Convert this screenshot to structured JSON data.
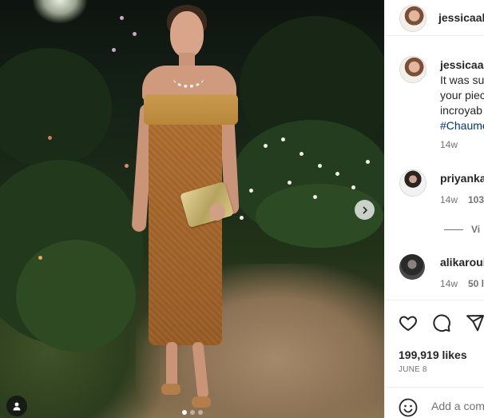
{
  "post": {
    "username": "jessicaalba",
    "carousel": {
      "slide_index": 1,
      "slide_count": 3
    }
  },
  "caption": {
    "username": "jessicaalba",
    "lines": [
      "It was su",
      "your piec",
      "incroyab"
    ],
    "hashtag": "#Chaume",
    "time": "14w"
  },
  "comments": [
    {
      "username": "priyanka",
      "time": "14w",
      "likes": "103"
    },
    {
      "username": "alikaroui",
      "time": "14w",
      "likes": "50 l"
    }
  ],
  "view_replies": "Vi",
  "likes": "199,919 likes",
  "date": "JUNE 8",
  "add_comment_placeholder": "Add a com",
  "icons": {
    "next": "chevron-right-icon",
    "tag": "user-tag-icon",
    "like": "heart-icon",
    "comment": "comment-icon",
    "share": "share-icon",
    "emoji": "emoji-icon"
  },
  "colors": {
    "hashtag": "#00376b",
    "meta": "#737373",
    "text": "#262626"
  }
}
